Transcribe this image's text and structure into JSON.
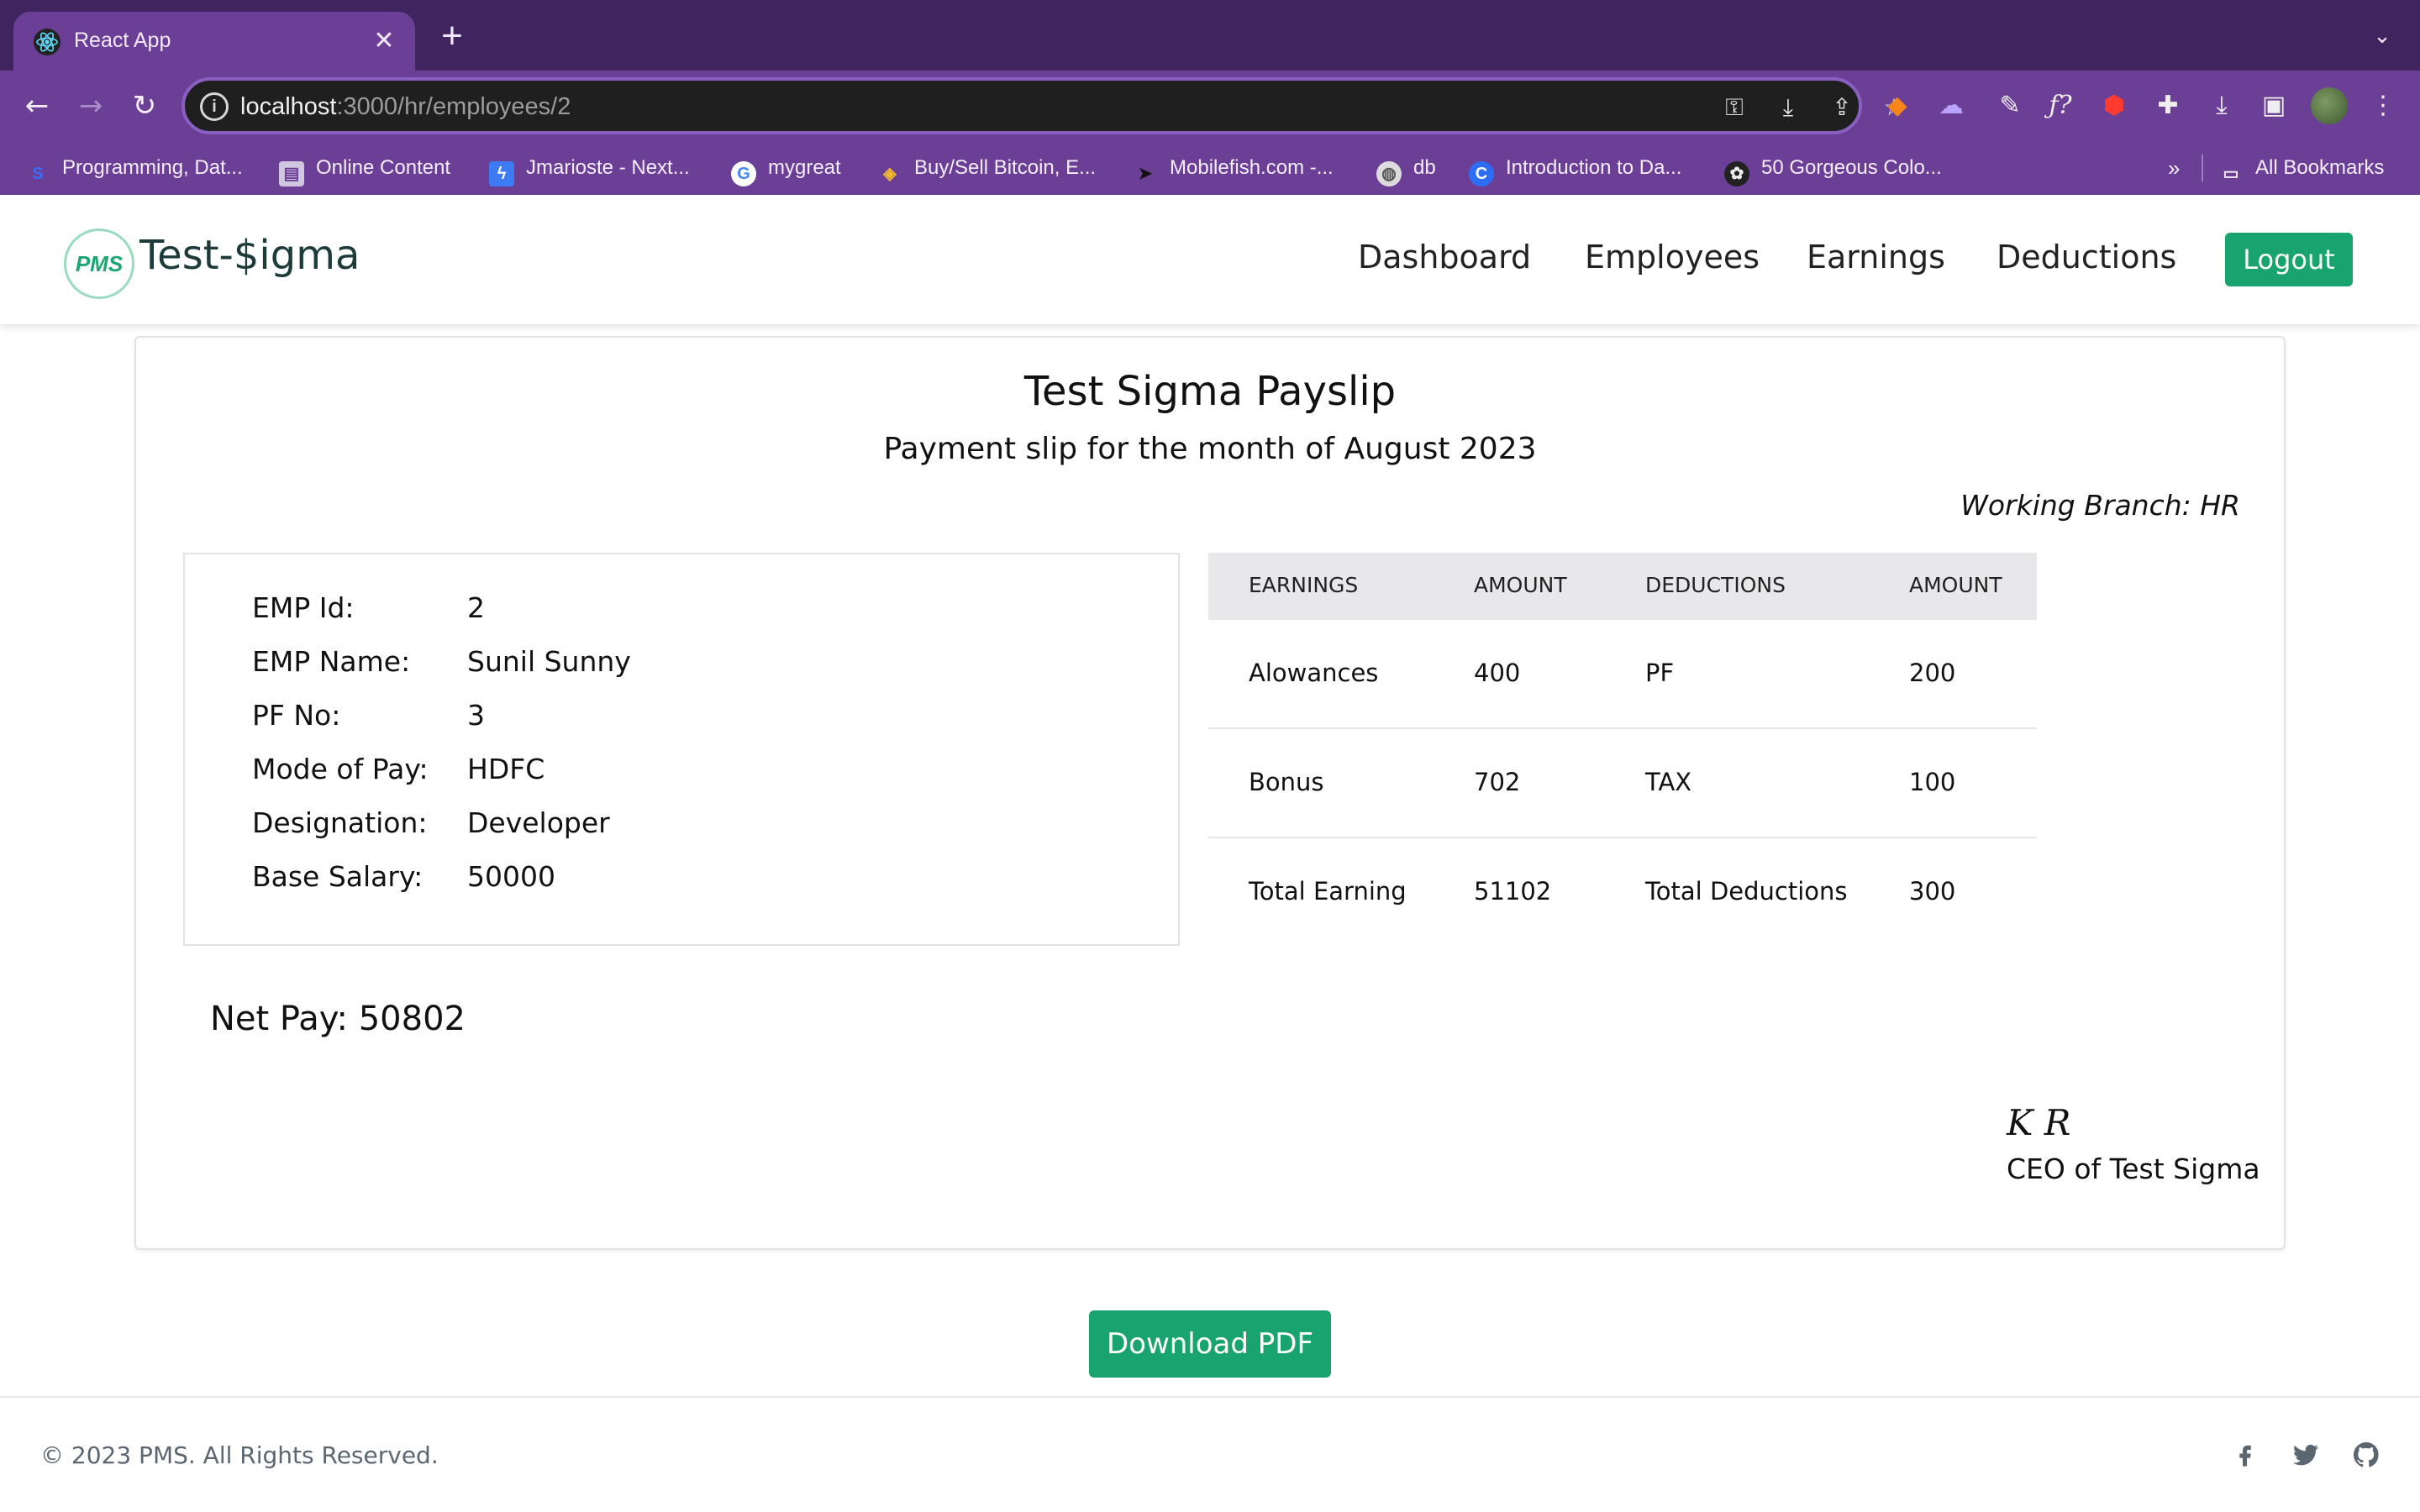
{
  "browser": {
    "tab_title": "React App",
    "url_host": "localhost",
    "url_path": ":3000/hr/employees/2",
    "bookmarks": [
      {
        "label": "Programming, Dat...",
        "icon": "s-icon",
        "color": "#3b6cf6"
      },
      {
        "label": "Online Content",
        "icon": "book-icon",
        "color": "#d0c6e0"
      },
      {
        "label": "Jmarioste - Next...",
        "icon": "bolt-icon",
        "color": "#3d7bf2"
      },
      {
        "label": "mygreat",
        "icon": "google-icon",
        "color": "#ffffff"
      },
      {
        "label": "Buy/Sell Bitcoin, E...",
        "icon": "binance-icon",
        "color": "#f3ba2f"
      },
      {
        "label": "Mobilefish.com -...",
        "icon": "fish-icon",
        "color": "#111111"
      },
      {
        "label": "db",
        "icon": "globe-icon",
        "color": "#dcdcdc"
      },
      {
        "label": "Introduction to Da...",
        "icon": "c-icon",
        "color": "#2d6df6"
      },
      {
        "label": "50 Gorgeous Colo...",
        "icon": "palette-icon",
        "color": "#222222"
      }
    ],
    "all_bookmarks": "All Bookmarks"
  },
  "app": {
    "brand_logo": "PMS",
    "brand_name": "Test-$igma",
    "nav": [
      "Dashboard",
      "Employees",
      "Earnings",
      "Deductions"
    ],
    "logout": "Logout",
    "accent_color": "#19a46f"
  },
  "payslip": {
    "title": "Test Sigma Payslip",
    "subtitle": "Payment slip for the month of August 2023",
    "branch": "Working Branch: HR",
    "employee": [
      {
        "label": "EMP Id:",
        "value": "2"
      },
      {
        "label": "EMP Name:",
        "value": "Sunil Sunny"
      },
      {
        "label": "PF No:",
        "value": "3"
      },
      {
        "label": "Mode of Pay:",
        "value": "HDFC"
      },
      {
        "label": "Designation:",
        "value": "Developer"
      },
      {
        "label": "Base Salary:",
        "value": "50000"
      }
    ],
    "table_headers": [
      "EARNINGS",
      "AMOUNT",
      "DEDUCTIONS",
      "AMOUNT"
    ],
    "table_rows": [
      [
        "Alowances",
        "400",
        "PF",
        "200"
      ],
      [
        "Bonus",
        "702",
        "TAX",
        "100"
      ],
      [
        "Total Earning",
        "51102",
        "Total Deductions",
        "300"
      ]
    ],
    "net_pay": "Net Pay: 50802",
    "signature_initials": "K R",
    "signature_title": "CEO of Test Sigma"
  },
  "download_label": "Download PDF",
  "footer": {
    "copyright": "© 2023 PMS. All Rights Reserved.",
    "social": [
      "facebook-icon",
      "twitter-icon",
      "github-icon"
    ]
  }
}
